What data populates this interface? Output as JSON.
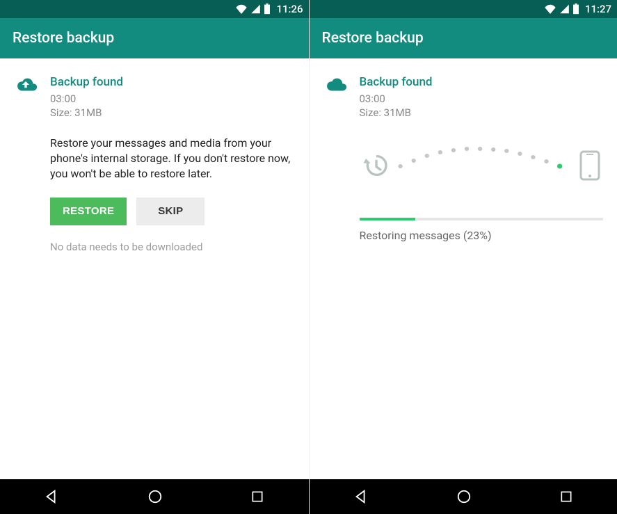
{
  "left": {
    "statusTime": "11:26",
    "appBarTitle": "Restore backup",
    "backupTitle": "Backup found",
    "backupTime": "03:00",
    "backupSize": "Size: 31MB",
    "description": "Restore your messages and media from your phone's internal storage. If you don't restore now, you won't be able to restore later.",
    "restoreLabel": "RESTORE",
    "skipLabel": "SKIP",
    "noDataText": "No data needs to be downloaded"
  },
  "right": {
    "statusTime": "11:27",
    "appBarTitle": "Restore backup",
    "backupTitle": "Backup found",
    "backupTime": "03:00",
    "backupSize": "Size: 31MB",
    "progressPercent": 23,
    "progressLabel": "Restoring messages (23%)"
  },
  "colors": {
    "statusBar": "#075E54",
    "appBar": "#128C7E",
    "accent": "#128C7E",
    "buttonPrimary": "#4CBB5B",
    "progress": "#2ECC71"
  }
}
